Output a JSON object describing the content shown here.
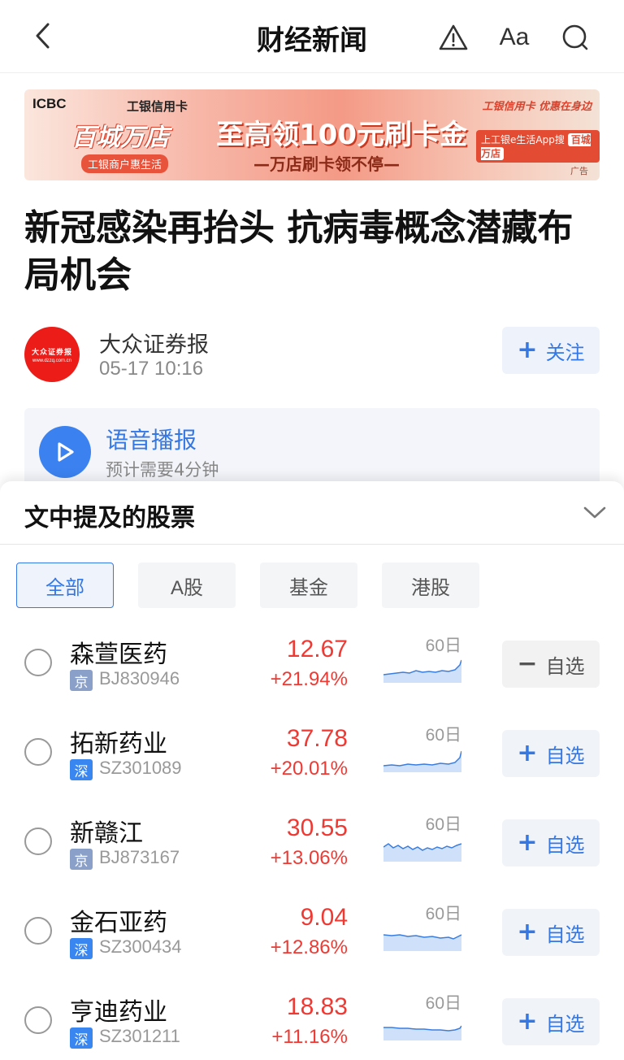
{
  "nav": {
    "title": "财经新闻",
    "font_label": "Aa",
    "back_icon": "chevron-left-icon",
    "warn_icon": "warning-triangle-icon",
    "search_icon": "search-icon"
  },
  "ad": {
    "brand": "ICBC",
    "brand_sub": "工银信用卡",
    "logo_text": "百城万店",
    "logo_sub": "工银商户惠生活",
    "headline": "至高领100元刷卡金",
    "slogan": "—万店刷卡领不停—",
    "pill_text": "上工银e生活App搜",
    "pill_keyword": "百城万店",
    "corner": "工银信用卡 优惠在身边",
    "ad_label": "广告"
  },
  "article": {
    "title": "新冠感染再抬头 抗病毒概念潜藏布局机会",
    "author": "大众证券报",
    "time": "05-17 10:16",
    "avatar_text": "大众证券报",
    "avatar_url": "www.dzzq.com.cn",
    "follow_label": "关注"
  },
  "audio": {
    "title": "语音播报",
    "subtitle": "预计需要4分钟"
  },
  "stocks_sheet": {
    "title": "文中提及的股票",
    "tabs": [
      {
        "label": "全部",
        "active": true
      },
      {
        "label": "A股",
        "active": false
      },
      {
        "label": "基金",
        "active": false
      },
      {
        "label": "港股",
        "active": false
      }
    ],
    "spark_label": "60日",
    "colors": {
      "up": "#ef3a34",
      "accent": "#3478e6"
    },
    "items": [
      {
        "name": "森萱医药",
        "market": "京",
        "code": "BJ830946",
        "price": "12.67",
        "change": "+21.94%",
        "in_watchlist": true,
        "button_label": "自选"
      },
      {
        "name": "拓新药业",
        "market": "深",
        "code": "SZ301089",
        "price": "37.78",
        "change": "+20.01%",
        "in_watchlist": false,
        "button_label": "自选"
      },
      {
        "name": "新赣江",
        "market": "京",
        "code": "BJ873167",
        "price": "30.55",
        "change": "+13.06%",
        "in_watchlist": false,
        "button_label": "自选"
      },
      {
        "name": "金石亚药",
        "market": "深",
        "code": "SZ300434",
        "price": "9.04",
        "change": "+12.86%",
        "in_watchlist": false,
        "button_label": "自选"
      },
      {
        "name": "亨迪药业",
        "market": "深",
        "code": "SZ301211",
        "price": "18.83",
        "change": "+11.16%",
        "in_watchlist": false,
        "button_label": "自选"
      }
    ]
  }
}
